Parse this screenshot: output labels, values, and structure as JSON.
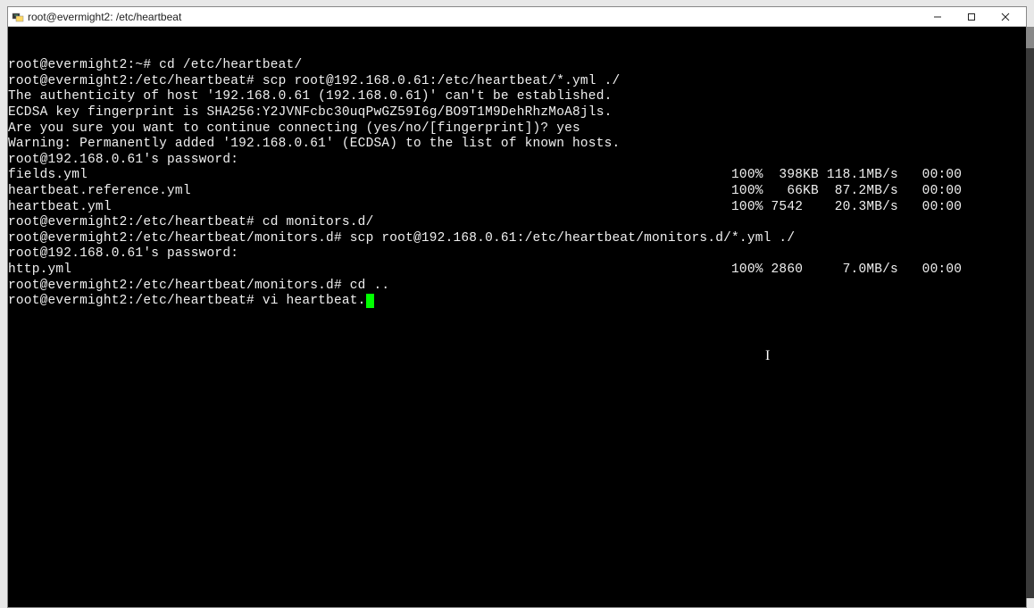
{
  "window": {
    "title": "root@evermight2: /etc/heartbeat"
  },
  "terminal": {
    "lines": [
      "root@evermight2:~# cd /etc/heartbeat/",
      "root@evermight2:/etc/heartbeat# scp root@192.168.0.61:/etc/heartbeat/*.yml ./",
      "The authenticity of host '192.168.0.61 (192.168.0.61)' can't be established.",
      "ECDSA key fingerprint is SHA256:Y2JVNFcbc30uqPwGZ59I6g/BO9T1M9DehRhzMoA8jls.",
      "Are you sure you want to continue connecting (yes/no/[fingerprint])? yes",
      "Warning: Permanently added '192.168.0.61' (ECDSA) to the list of known hosts.",
      "root@192.168.0.61's password:",
      "fields.yml                                                                                 100%  398KB 118.1MB/s   00:00",
      "heartbeat.reference.yml                                                                    100%   66KB  87.2MB/s   00:00",
      "heartbeat.yml                                                                              100% 7542    20.3MB/s   00:00",
      "root@evermight2:/etc/heartbeat# cd monitors.d/",
      "root@evermight2:/etc/heartbeat/monitors.d# scp root@192.168.0.61:/etc/heartbeat/monitors.d/*.yml ./",
      "root@192.168.0.61's password:",
      "http.yml                                                                                   100% 2860     7.0MB/s   00:00",
      "root@evermight2:/etc/heartbeat/monitors.d# cd ..",
      "root@evermight2:/etc/heartbeat# vi heartbeat."
    ],
    "current_input": "vi heartbeat."
  }
}
